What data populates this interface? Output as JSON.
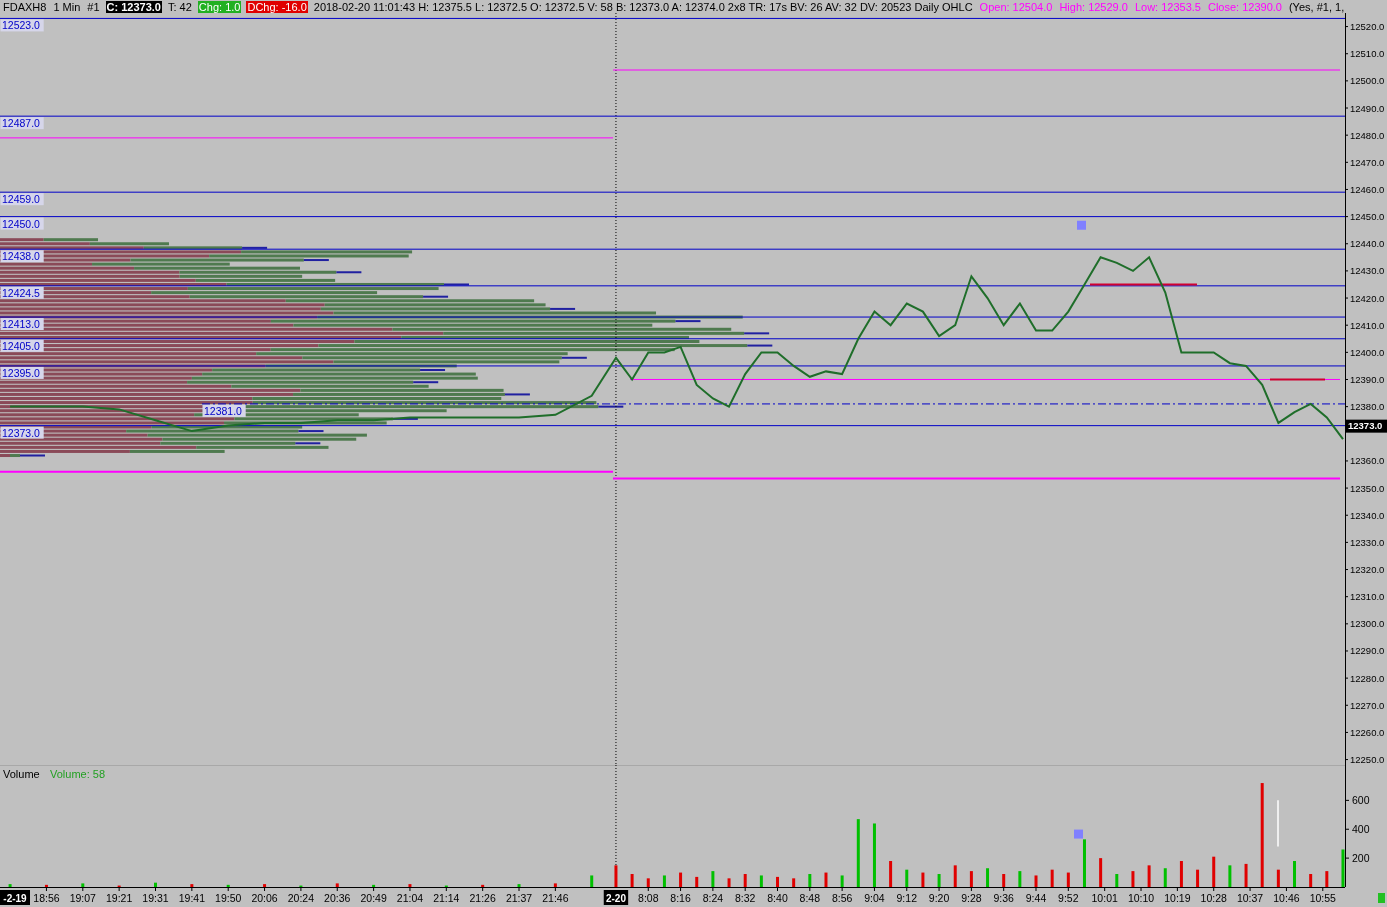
{
  "header": {
    "items": [
      {
        "text": "FDAXH8",
        "kind": "plain"
      },
      {
        "text": "1 Min",
        "kind": "plain"
      },
      {
        "text": "#1",
        "kind": "plain"
      },
      {
        "text": "C: 12373.0",
        "kind": "dark"
      },
      {
        "text": "T: 42",
        "kind": "plain"
      },
      {
        "text": "Chg: 1.0",
        "kind": "green"
      },
      {
        "text": "DChg: -16.0",
        "kind": "red"
      },
      {
        "text": "2018-02-20 11:01:43 H: 12375.5 L: 12372.5 O: 12372.5 V: 58 B: 12373.0 A: 12374.0 2x8 TR: 17s BV: 26 AV: 32 DV: 20523 Daily OHLC",
        "kind": "plain"
      },
      {
        "text": "Open: 12504.0",
        "kind": "magenta"
      },
      {
        "text": "High: 12529.0",
        "kind": "magenta"
      },
      {
        "text": "Low: 12353.5",
        "kind": "magenta"
      },
      {
        "text": "Close: 12390.0",
        "kind": "magenta"
      },
      {
        "text": "(Yes, #1, 1,",
        "kind": "plain"
      }
    ]
  },
  "price_chart": {
    "last_price": "12373.0",
    "chart_data": {
      "type": "line",
      "ylim": [
        12248,
        12525
      ],
      "series": [
        {
          "color": "#1f6e2a",
          "values": [
            null,
            null,
            12380,
            null,
            null,
            null,
            null,
            null,
            null,
            null,
            null,
            12380,
            null,
            null,
            null,
            null,
            null,
            null,
            null,
            null,
            12380,
            null,
            null,
            null,
            null,
            null,
            null,
            null,
            null,
            12379,
            null,
            null,
            null,
            null,
            null,
            null,
            null,
            null,
            12375,
            null,
            null,
            null,
            null,
            null,
            null,
            null,
            null,
            12371,
            null,
            null,
            null,
            null,
            null,
            null,
            null,
            null,
            12373,
            null,
            null,
            null,
            null,
            null,
            null,
            null,
            null,
            12374,
            null,
            null,
            null,
            null,
            null,
            null,
            null,
            null,
            12374,
            null,
            null,
            null,
            null,
            null,
            null,
            null,
            null,
            12375,
            null,
            null,
            null,
            null,
            null,
            null,
            null,
            null,
            12375,
            null,
            null,
            null,
            null,
            null,
            null,
            null,
            null,
            12376,
            null,
            null,
            null,
            null,
            null,
            null,
            null,
            null,
            12376,
            null,
            null,
            null,
            null,
            null,
            null,
            null,
            null,
            12376,
            null,
            null,
            null,
            null,
            null,
            null,
            null,
            null,
            12376,
            null,
            null,
            null,
            null,
            null,
            null,
            null,
            null,
            12377,
            null,
            null,
            null,
            null,
            null,
            null,
            null,
            null,
            12384,
            null,
            null,
            null,
            null,
            null,
            12398,
            null,
            null,
            null,
            12390,
            null,
            null,
            null,
            12400,
            null,
            null,
            null,
            12400,
            null,
            null,
            null,
            12402,
            null,
            null,
            null,
            12388,
            null,
            null,
            null,
            12383,
            null,
            null,
            null,
            12380,
            null,
            null,
            null,
            12392,
            null,
            null,
            null,
            12400,
            null,
            null,
            null,
            12400,
            null,
            null,
            null,
            12395,
            null,
            null,
            null,
            12391,
            null,
            null,
            null,
            12393,
            null,
            null,
            null,
            12392,
            null,
            null,
            null,
            12405,
            null,
            null,
            null,
            12415,
            null,
            null,
            null,
            12410,
            null,
            null,
            null,
            12418,
            null,
            null,
            null,
            12415,
            null,
            null,
            null,
            12406,
            null,
            null,
            null,
            12410,
            null,
            null,
            null,
            12428,
            null,
            null,
            null,
            12420,
            null,
            null,
            null,
            12410,
            null,
            null,
            null,
            12418,
            null,
            null,
            null,
            12408,
            null,
            null,
            null,
            12408,
            null,
            null,
            null,
            12415,
            null,
            null,
            null,
            12425,
            null,
            null,
            null,
            12435,
            null,
            null,
            null,
            12433,
            null,
            null,
            null,
            12430,
            null,
            null,
            null,
            12435,
            null,
            null,
            null,
            12422,
            null,
            null,
            null,
            12400,
            null,
            null,
            null,
            12400,
            null,
            null,
            null,
            12400,
            null,
            null,
            null,
            12396,
            null,
            null,
            null,
            12395,
            null,
            null,
            null,
            12388,
            null,
            null,
            null,
            12374,
            null,
            null,
            null,
            12378,
            null,
            null,
            null,
            12381,
            null,
            null,
            null,
            12376,
            null,
            null,
            null,
            12368
          ]
        }
      ],
      "yticks": [
        {
          "value": 12520,
          "label": "12520.0"
        },
        {
          "value": 12510,
          "label": "12510.0"
        },
        {
          "value": 12500,
          "label": "12500.0"
        },
        {
          "value": 12490,
          "label": "12490.0"
        },
        {
          "value": 12480,
          "label": "12480.0"
        },
        {
          "value": 12470,
          "label": "12470.0"
        },
        {
          "value": 12460,
          "label": "12460.0"
        },
        {
          "value": 12450,
          "label": "12450.0"
        },
        {
          "value": 12440,
          "label": "12440.0"
        },
        {
          "value": 12430,
          "label": "12430.0"
        },
        {
          "value": 12420,
          "label": "12420.0"
        },
        {
          "value": 12410,
          "label": "12410.0"
        },
        {
          "value": 12400,
          "label": "12400.0"
        },
        {
          "value": 12390,
          "label": "12390.0"
        },
        {
          "value": 12380,
          "label": "12380.0"
        },
        {
          "value": 12360,
          "label": "12360.0"
        },
        {
          "value": 12350,
          "label": "12350.0"
        },
        {
          "value": 12340,
          "label": "12340.0"
        },
        {
          "value": 12330,
          "label": "12330.0"
        },
        {
          "value": 12320,
          "label": "12320.0"
        },
        {
          "value": 12310,
          "label": "12310.0"
        },
        {
          "value": 12300,
          "label": "12300.0"
        },
        {
          "value": 12290,
          "label": "12290.0"
        },
        {
          "value": 12280,
          "label": "12280.0"
        },
        {
          "value": 12270,
          "label": "12270.0"
        },
        {
          "value": 12260,
          "label": "12260.0"
        },
        {
          "value": 12250,
          "label": "12250.0"
        }
      ],
      "ref_lines": [
        {
          "axis": "y",
          "value": 12523,
          "label": "12523.0",
          "color": "#0000c8"
        },
        {
          "axis": "y",
          "value": 12487,
          "label": "12487.0",
          "color": "#0000c8"
        },
        {
          "axis": "y",
          "value": 12459,
          "label": "12459.0",
          "color": "#0000c8"
        },
        {
          "axis": "y",
          "value": 12450,
          "label": "12450.0",
          "color": "#0000c8"
        },
        {
          "axis": "y",
          "value": 12438,
          "label": "12438.0",
          "color": "#0000c8"
        },
        {
          "axis": "y",
          "value": 12424.5,
          "label": "12424.5",
          "color": "#0000c8"
        },
        {
          "axis": "y",
          "value": 12413,
          "label": "12413.0",
          "color": "#0000c8"
        },
        {
          "axis": "y",
          "value": 12405,
          "label": "12405.0",
          "color": "#0000c8"
        },
        {
          "axis": "y",
          "value": 12395,
          "label": "12395.0",
          "color": "#0000c8"
        },
        {
          "axis": "y",
          "value": 12373,
          "label": "12373.0",
          "color": "#0000c8"
        },
        {
          "axis": "y",
          "value": 12381,
          "label": "12381.0",
          "color": "#0000c8"
        },
        {
          "axis": "y",
          "value": 12479,
          "color": "#ff00ff"
        },
        {
          "axis": "y",
          "value": 12356,
          "color": "#ff00ff"
        },
        {
          "axis": "y",
          "value": 12504,
          "color": "#ff00ff"
        },
        {
          "axis": "y",
          "value": 12353.5,
          "color": "#ff00ff"
        },
        {
          "axis": "y",
          "value": 12390,
          "color": "#ff00ff"
        }
      ]
    }
  },
  "volume_chart": {
    "title": "Volume",
    "reading": "Volume: 58",
    "chart_data": {
      "type": "bar",
      "ylim": [
        0,
        845
      ],
      "yticks": [
        {
          "value": 200,
          "label": "200"
        },
        {
          "value": 400,
          "label": "400"
        },
        {
          "value": 600,
          "label": "600"
        }
      ],
      "categories": [
        null,
        null,
        null,
        null,
        null,
        null,
        null,
        null,
        null,
        null,
        null,
        "18:56",
        null,
        null,
        null,
        null,
        null,
        null,
        null,
        null,
        "19:07",
        null,
        null,
        null,
        null,
        null,
        null,
        null,
        null,
        "19:21",
        null,
        null,
        null,
        null,
        null,
        null,
        null,
        null,
        "19:31",
        null,
        null,
        null,
        null,
        null,
        null,
        null,
        null,
        "19:41",
        null,
        null,
        null,
        null,
        null,
        null,
        null,
        null,
        "19:50",
        null,
        null,
        null,
        null,
        null,
        null,
        null,
        null,
        "20:06",
        null,
        null,
        null,
        null,
        null,
        null,
        null,
        null,
        "20:24",
        null,
        null,
        null,
        null,
        null,
        null,
        null,
        null,
        "20:36",
        null,
        null,
        null,
        null,
        null,
        null,
        null,
        null,
        "20:49",
        null,
        null,
        null,
        null,
        null,
        null,
        null,
        null,
        "21:04",
        null,
        null,
        null,
        null,
        null,
        null,
        null,
        null,
        "21:14",
        null,
        null,
        null,
        null,
        null,
        null,
        null,
        null,
        "21:26",
        null,
        null,
        null,
        null,
        null,
        null,
        null,
        null,
        "21:37",
        null,
        null,
        null,
        null,
        null,
        null,
        null,
        null,
        "21:46",
        null,
        null,
        null,
        null,
        null,
        null,
        null,
        null,
        null,
        null,
        null,
        null,
        null,
        null,
        null,
        null,
        null,
        null,
        null,
        null,
        null,
        null,
        "8:08",
        null,
        null,
        null,
        null,
        null,
        null,
        null,
        "8:16",
        null,
        null,
        null,
        null,
        null,
        null,
        null,
        "8:24",
        null,
        null,
        null,
        null,
        null,
        null,
        null,
        "8:32",
        null,
        null,
        null,
        null,
        null,
        null,
        null,
        "8:40",
        null,
        null,
        null,
        null,
        null,
        null,
        null,
        "8:48",
        null,
        null,
        null,
        null,
        null,
        null,
        null,
        "8:56",
        null,
        null,
        null,
        null,
        null,
        null,
        null,
        "9:04",
        null,
        null,
        null,
        null,
        null,
        null,
        null,
        "9:12",
        null,
        null,
        null,
        null,
        null,
        null,
        null,
        "9:20",
        null,
        null,
        null,
        null,
        null,
        null,
        null,
        "9:28",
        null,
        null,
        null,
        null,
        null,
        null,
        null,
        "9:36",
        null,
        null,
        null,
        null,
        null,
        null,
        null,
        "9:44",
        null,
        null,
        null,
        null,
        null,
        null,
        null,
        "9:52",
        null,
        null,
        null,
        null,
        null,
        null,
        null,
        null,
        "10:01",
        null,
        null,
        null,
        null,
        null,
        null,
        null,
        null,
        "10:10",
        null,
        null,
        null,
        null,
        null,
        null,
        null,
        null,
        "10:19",
        null,
        null,
        null,
        null,
        null,
        null,
        null,
        null,
        "10:28",
        null,
        null,
        null,
        null,
        null,
        null,
        null,
        null,
        "10:37",
        null,
        null,
        null,
        null,
        null,
        null,
        null,
        null,
        "10:46",
        null,
        null,
        null,
        null,
        null,
        null,
        null,
        null,
        "10:55",
        null,
        null,
        null,
        null,
        null
      ],
      "series": [
        {
          "color": "#00c000",
          "values": [
            null,
            null,
            20,
            null,
            null,
            null,
            null,
            null,
            null,
            null,
            null,
            null,
            null,
            null,
            null,
            null,
            null,
            null,
            null,
            null,
            25,
            null,
            null,
            null,
            null,
            null,
            null,
            null,
            null,
            null,
            null,
            null,
            null,
            null,
            null,
            null,
            null,
            null,
            30,
            null,
            null,
            null,
            null,
            null,
            null,
            null,
            null,
            null,
            null,
            null,
            null,
            null,
            null,
            null,
            null,
            null,
            15,
            null,
            null,
            null,
            null,
            null,
            null,
            null,
            null,
            null,
            null,
            null,
            null,
            null,
            null,
            null,
            null,
            null,
            10,
            null,
            null,
            null,
            null,
            null,
            null,
            null,
            null,
            null,
            null,
            null,
            null,
            null,
            null,
            null,
            null,
            null,
            15,
            null,
            null,
            null,
            null,
            null,
            null,
            null,
            null,
            null,
            null,
            null,
            null,
            null,
            null,
            null,
            null,
            null,
            10,
            null,
            null,
            null,
            null,
            null,
            null,
            null,
            null,
            null,
            null,
            null,
            null,
            null,
            null,
            null,
            null,
            null,
            20,
            null,
            null,
            null,
            null,
            null,
            null,
            null,
            null,
            null,
            null,
            null,
            null,
            null,
            null,
            null,
            null,
            null,
            80,
            null,
            null,
            null,
            null,
            null,
            null,
            null,
            null,
            null,
            null,
            null,
            null,
            null,
            null,
            null,
            null,
            null,
            80,
            null,
            null,
            null,
            null,
            null,
            null,
            null,
            null,
            null,
            null,
            null,
            110,
            null,
            null,
            null,
            null,
            null,
            null,
            null,
            null,
            null,
            null,
            null,
            80,
            null,
            null,
            null,
            null,
            null,
            null,
            null,
            null,
            null,
            null,
            null,
            90,
            null,
            null,
            null,
            null,
            null,
            null,
            null,
            80,
            null,
            null,
            null,
            470,
            null,
            null,
            null,
            440,
            null,
            null,
            null,
            null,
            null,
            null,
            null,
            120,
            null,
            null,
            null,
            null,
            null,
            null,
            null,
            90,
            null,
            null,
            null,
            null,
            null,
            null,
            null,
            null,
            null,
            null,
            null,
            130,
            null,
            null,
            null,
            null,
            null,
            null,
            null,
            110,
            null,
            null,
            null,
            null,
            null,
            null,
            null,
            null,
            null,
            null,
            null,
            null,
            null,
            null,
            null,
            330,
            null,
            null,
            null,
            null,
            null,
            null,
            null,
            90,
            null,
            null,
            null,
            null,
            null,
            null,
            null,
            null,
            null,
            null,
            null,
            130,
            null,
            null,
            null,
            null,
            null,
            null,
            null,
            null,
            null,
            null,
            null,
            null,
            null,
            null,
            null,
            150,
            null,
            null,
            null,
            null,
            null,
            null,
            null,
            null,
            null,
            null,
            null,
            null,
            null,
            null,
            null,
            180,
            null,
            null,
            null,
            null,
            null,
            null,
            null,
            null,
            null,
            null,
            null,
            260
          ]
        },
        {
          "color": "#e00000",
          "values": [
            null,
            null,
            null,
            null,
            null,
            null,
            null,
            null,
            null,
            null,
            null,
            15,
            null,
            null,
            null,
            null,
            null,
            null,
            null,
            null,
            null,
            null,
            null,
            null,
            null,
            null,
            null,
            null,
            null,
            10,
            null,
            null,
            null,
            null,
            null,
            null,
            null,
            null,
            null,
            null,
            null,
            null,
            null,
            null,
            null,
            null,
            null,
            20,
            null,
            null,
            null,
            null,
            null,
            null,
            null,
            null,
            null,
            null,
            null,
            null,
            null,
            null,
            null,
            null,
            null,
            20,
            null,
            null,
            null,
            null,
            null,
            null,
            null,
            null,
            null,
            null,
            null,
            null,
            null,
            null,
            null,
            null,
            null,
            25,
            null,
            null,
            null,
            null,
            null,
            null,
            null,
            null,
            null,
            null,
            null,
            null,
            null,
            null,
            null,
            null,
            null,
            20,
            null,
            null,
            null,
            null,
            null,
            null,
            null,
            null,
            null,
            null,
            null,
            null,
            null,
            null,
            null,
            null,
            null,
            15,
            null,
            null,
            null,
            null,
            null,
            null,
            null,
            null,
            null,
            null,
            null,
            null,
            null,
            null,
            null,
            null,
            null,
            25,
            null,
            null,
            null,
            null,
            null,
            null,
            null,
            null,
            null,
            null,
            null,
            null,
            null,
            null,
            150,
            null,
            null,
            null,
            90,
            null,
            null,
            null,
            60,
            null,
            null,
            null,
            null,
            null,
            null,
            null,
            100,
            null,
            null,
            null,
            70,
            null,
            null,
            null,
            null,
            null,
            null,
            null,
            60,
            null,
            null,
            null,
            90,
            null,
            null,
            null,
            null,
            null,
            null,
            null,
            70,
            null,
            null,
            null,
            60,
            null,
            null,
            null,
            null,
            null,
            null,
            null,
            100,
            null,
            null,
            null,
            null,
            null,
            null,
            null,
            null,
            null,
            null,
            null,
            null,
            null,
            null,
            null,
            180,
            null,
            null,
            null,
            null,
            null,
            null,
            null,
            100,
            null,
            null,
            null,
            null,
            null,
            null,
            null,
            150,
            null,
            null,
            null,
            110,
            null,
            null,
            null,
            null,
            null,
            null,
            null,
            90,
            null,
            null,
            null,
            null,
            null,
            null,
            null,
            80,
            null,
            null,
            null,
            120,
            null,
            null,
            null,
            100,
            null,
            null,
            null,
            null,
            null,
            null,
            null,
            200,
            null,
            null,
            null,
            null,
            null,
            null,
            null,
            110,
            null,
            null,
            null,
            150,
            null,
            null,
            null,
            null,
            null,
            null,
            null,
            180,
            null,
            null,
            null,
            120,
            null,
            null,
            null,
            210,
            null,
            null,
            null,
            null,
            null,
            null,
            null,
            160,
            null,
            null,
            null,
            720,
            null,
            null,
            null,
            120,
            null,
            null,
            null,
            null,
            null,
            null,
            null,
            90,
            null,
            null,
            null,
            110,
            null,
            null,
            null,
            null
          ]
        }
      ]
    }
  },
  "time_axis": {
    "session_markers": [
      {
        "label": "-2-19"
      },
      {
        "label": "2-20"
      }
    ]
  }
}
